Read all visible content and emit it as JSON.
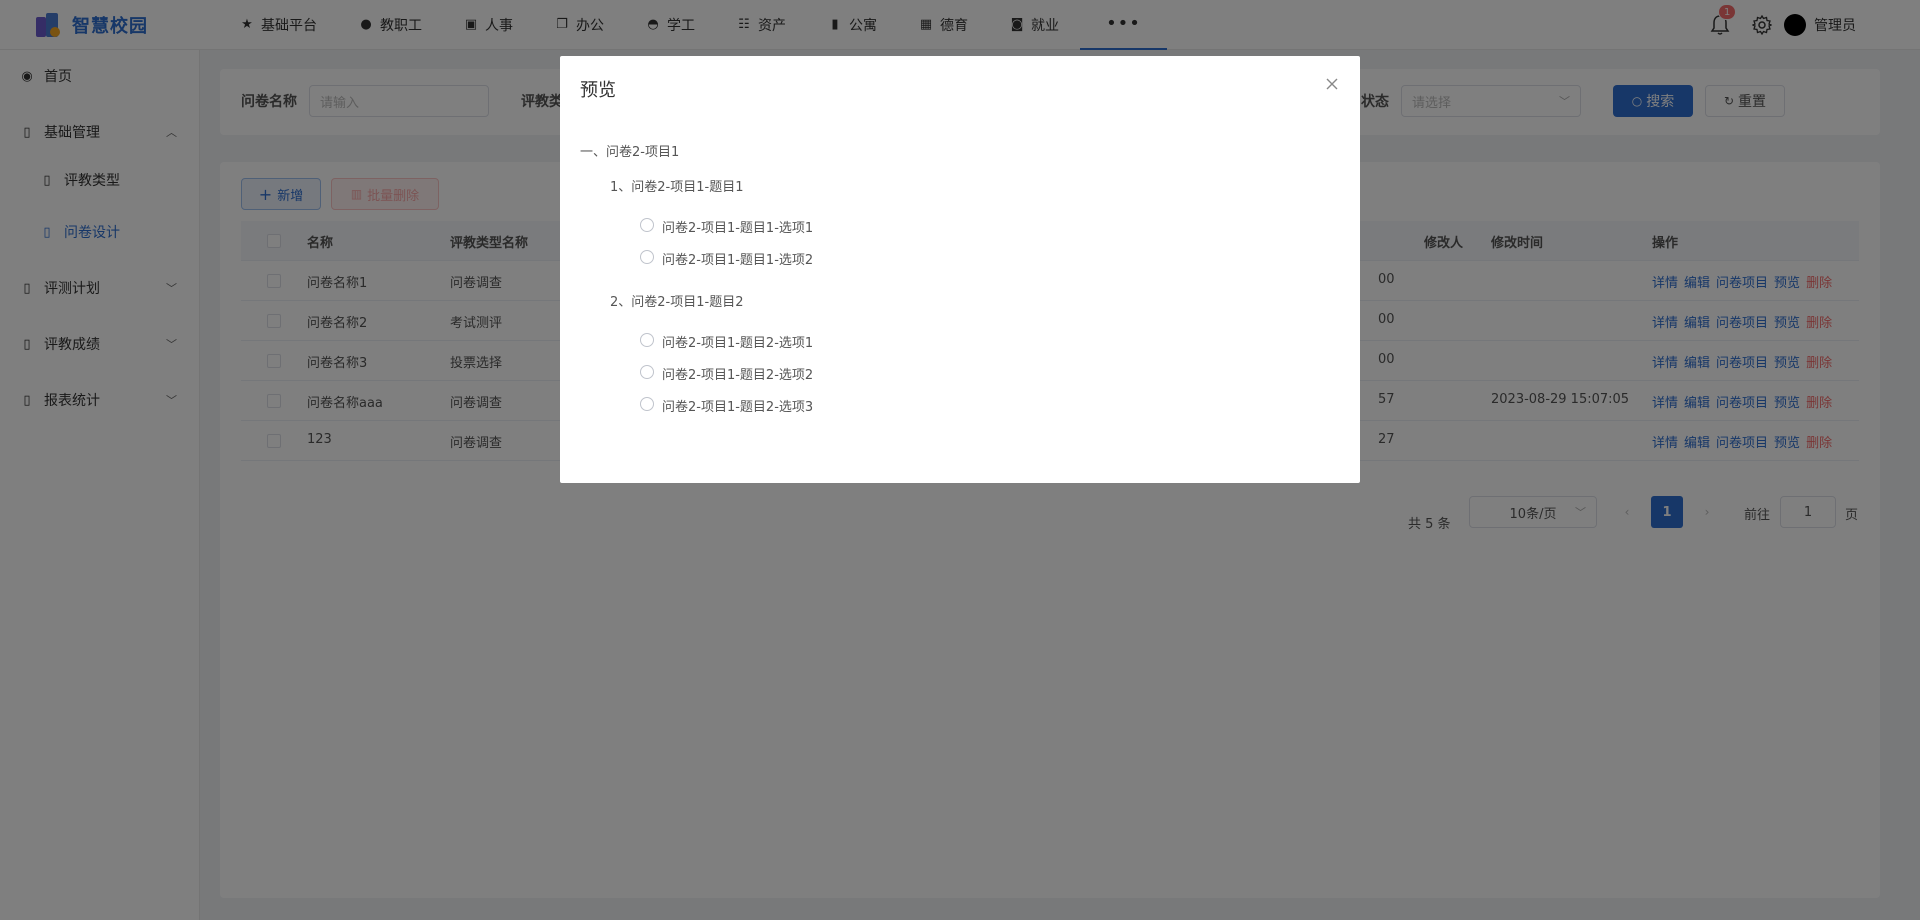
{
  "app": {
    "title": "智慧校园"
  },
  "topnav": {
    "items": [
      {
        "label": "基础平台",
        "icon": "star-icon"
      },
      {
        "label": "教职工",
        "icon": "users-icon"
      },
      {
        "label": "人事",
        "icon": "id-card-icon"
      },
      {
        "label": "办公",
        "icon": "copy-icon"
      },
      {
        "label": "学工",
        "icon": "user-headset-icon"
      },
      {
        "label": "资产",
        "icon": "tree-list-icon"
      },
      {
        "label": "公寓",
        "icon": "building-icon"
      },
      {
        "label": "德育",
        "icon": "grid-icon"
      },
      {
        "label": "就业",
        "icon": "briefcase-icon"
      }
    ],
    "more_label": "•••"
  },
  "user": {
    "notification_count": "1",
    "name": "管理员"
  },
  "sidebar": {
    "items": [
      {
        "label": "首页",
        "icon": "dashboard-icon"
      },
      {
        "label": "基础管理",
        "icon": "book-icon",
        "expanded": true,
        "children": [
          {
            "label": "评教类型",
            "active": false
          },
          {
            "label": "问卷设计",
            "active": true
          }
        ]
      },
      {
        "label": "评测计划",
        "icon": "book-icon"
      },
      {
        "label": "评教成绩",
        "icon": "book-icon"
      },
      {
        "label": "报表统计",
        "icon": "book-icon"
      }
    ],
    "arrow_up": "︿",
    "arrow_down": "﹀"
  },
  "search": {
    "name_label": "问卷名称",
    "name_placeholder": "请输入",
    "type_label": "评教类",
    "status_label": "状态",
    "status_placeholder": "请选择",
    "search_button": "搜索",
    "reset_button": "重置"
  },
  "toolbar": {
    "add_button": "新增",
    "batch_delete_button": "批量删除"
  },
  "table": {
    "columns": {
      "name": "名称",
      "type_name": "评教类型名称",
      "modifier": "修改人",
      "modified_time": "修改时间",
      "ops": "操作"
    },
    "rows": [
      {
        "name": "问卷名称1",
        "type": "问卷调查",
        "partial": "00",
        "modifier": "",
        "time": ""
      },
      {
        "name": "问卷名称2",
        "type": "考试测评",
        "partial": "00",
        "modifier": "",
        "time": ""
      },
      {
        "name": "问卷名称3",
        "type": "投票选择",
        "partial": "00",
        "modifier": "",
        "time": ""
      },
      {
        "name": "问卷名称aaa",
        "type": "问卷调查",
        "partial": "57",
        "modifier": "",
        "time": "2023-08-29 15:07:05"
      },
      {
        "name": "123",
        "type": "问卷调查",
        "partial": "27",
        "modifier": "",
        "time": ""
      }
    ],
    "ops": {
      "detail": "详情",
      "edit": "编辑",
      "items": "问卷项目",
      "preview": "预览",
      "delete": "删除"
    }
  },
  "pagination": {
    "total": "共 5 条",
    "page_size": "10条/页",
    "current_page": "1",
    "goto_label": "前往",
    "goto_value": "1",
    "page_suffix": "页"
  },
  "modal": {
    "title": "预览",
    "section": "一、问卷2-项目1",
    "questions": [
      {
        "title": "1、问卷2-项目1-题目1",
        "options": [
          "问卷2-项目1-题目1-选项1",
          "问卷2-项目1-题目1-选项2"
        ]
      },
      {
        "title": "2、问卷2-项目1-题目2",
        "options": [
          "问卷2-项目1-题目2-选项1",
          "问卷2-项目1-题目2-选项2",
          "问卷2-项目1-题目2-选项3"
        ]
      }
    ]
  },
  "colors": {
    "primary": "#2f6fd0",
    "danger": "#f56c6c"
  }
}
